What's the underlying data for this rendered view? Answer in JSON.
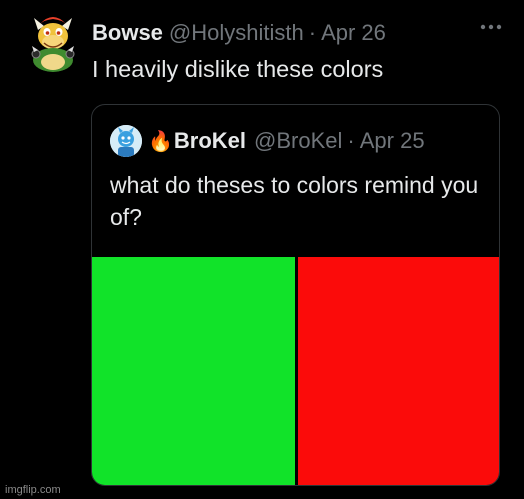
{
  "tweet": {
    "display_name": "Bowse",
    "handle": "@Holyshitisth",
    "separator": "·",
    "date": "Apr 26",
    "text": "I heavily dislike these colors",
    "more_icon": "more-horizontal-icon"
  },
  "quoted_tweet": {
    "name_emoji": "🔥",
    "display_name": "BroKel",
    "handle": "@BroKel",
    "separator": "·",
    "date": "Apr 25",
    "text": "what do theses to colors remind you of?",
    "swatches": {
      "left_color": "#11e329",
      "right_color": "#fb0b0a"
    }
  },
  "watermark": "imgflip.com"
}
